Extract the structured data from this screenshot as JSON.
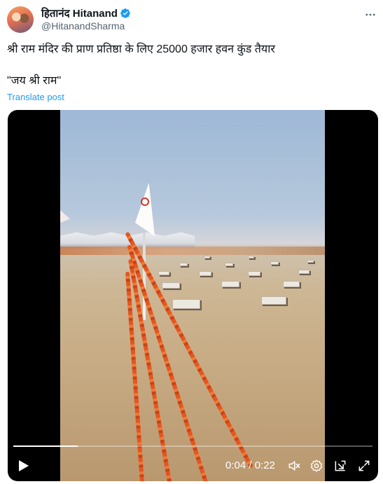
{
  "post": {
    "author": {
      "display_name": "हितानंद Hitanand",
      "handle": "@HitanandSharma",
      "verified": true
    },
    "text": "श्री राम मंदिर की प्राण प्रतिष्ठा  के लिए 25000 हजार हवन कुंड तैयार",
    "quote": "\"जय श्री राम\"",
    "translate_label": "Translate post"
  },
  "video": {
    "current_time": "0:04",
    "duration": "0:22",
    "time_display": "0:04 / 0:22",
    "progress": 0.18
  },
  "icons": {
    "more": "more-icon",
    "play": "play-icon",
    "mute": "mute-icon",
    "settings": "settings-icon",
    "pip": "picture-in-picture-icon",
    "fullscreen": "fullscreen-icon",
    "verified": "verified-badge-icon"
  },
  "colors": {
    "link": "#1d9bf0",
    "verified": "#1d9bf0",
    "secondary_text": "#536471",
    "primary_text": "#0f1419"
  }
}
